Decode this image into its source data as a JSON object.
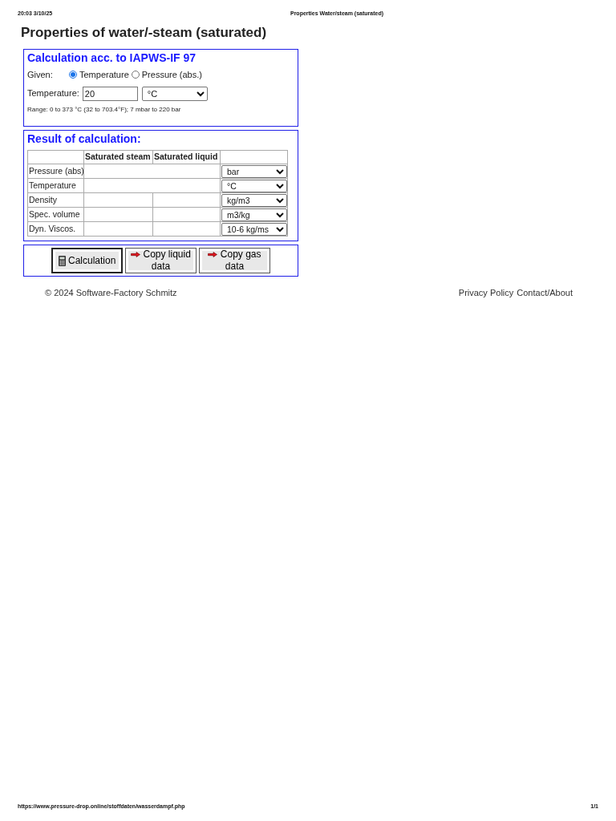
{
  "print_header": {
    "datetime": "20:03 3/10/25",
    "page_title": "Properties Water/steam (saturated)"
  },
  "title": "Properties of water/-steam (saturated)",
  "input_panel": {
    "heading": "Calculation acc. to IAPWS-IF 97",
    "given_label": "Given:",
    "given_options": [
      {
        "label": "Temperature",
        "selected": true
      },
      {
        "label": "Pressure (abs.)",
        "selected": false
      }
    ],
    "field_label": "Temperature:",
    "field_value": "20",
    "unit": "°C",
    "range_note": "Range: 0 to 373 °C (32 to 703.4°F); 7 mbar to 220 bar"
  },
  "result_panel": {
    "heading": "Result of calculation:",
    "columns": [
      "Saturated steam",
      "Saturated liquid"
    ],
    "rows": [
      {
        "label": "Pressure (abs)",
        "kind": "merged",
        "unit": "bar"
      },
      {
        "label": "Temperature",
        "kind": "merged",
        "unit": "°C"
      },
      {
        "label": "Density",
        "kind": "split",
        "unit": "kg/m3"
      },
      {
        "label": "Spec. volume",
        "kind": "split",
        "unit": "m3/kg"
      },
      {
        "label": "Dyn. Viscos.",
        "kind": "split",
        "unit": "10-6 kg/ms"
      }
    ]
  },
  "buttons": [
    {
      "label": "Calculation",
      "kind": "calculate",
      "focused": true
    },
    {
      "label": "Copy liquid data",
      "kind": "copy",
      "focused": false
    },
    {
      "label": "Copy gas data",
      "kind": "copy",
      "focused": false
    }
  ],
  "footer": {
    "copyright": "© 2024 Software-Factory Schmitz",
    "links": [
      "Privacy Policy",
      "Contact/About"
    ]
  },
  "print_footer": {
    "url": "https://www.pressure-drop.online/stoffdaten/wasserdampf.php",
    "page": "1/1"
  }
}
